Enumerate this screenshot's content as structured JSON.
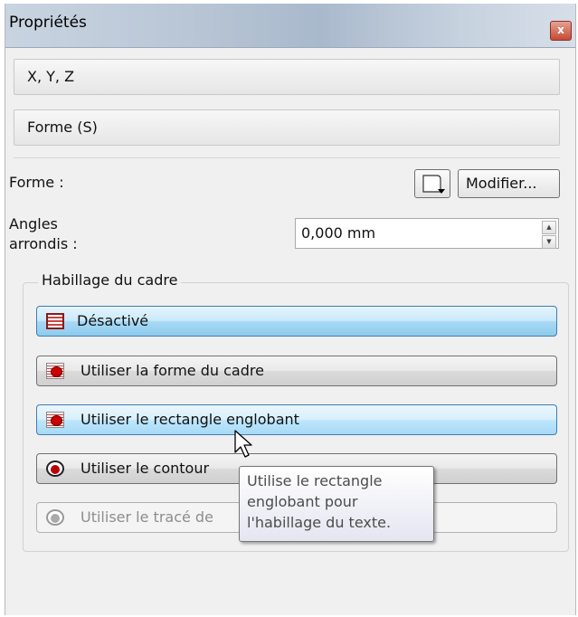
{
  "window": {
    "title": "Propriétés",
    "close_glyph": "x"
  },
  "sections": {
    "xyz": "X, Y, Z",
    "shape": "Forme (S)"
  },
  "shape_row": {
    "label": "Forme :",
    "modify_button": "Modifier..."
  },
  "corners": {
    "label_line1": "Angles",
    "label_line2": "arrondis :",
    "value": "0,000 mm"
  },
  "text_flow": {
    "group_title": "Habillage du cadre",
    "options": [
      {
        "label": "Désactivé",
        "icon": "frame-off-icon",
        "state": "selected"
      },
      {
        "label": "Utiliser la forme du cadre",
        "icon": "frame-shape-icon",
        "state": "normal"
      },
      {
        "label": "Utiliser le rectangle englobant",
        "icon": "bounding-box-icon",
        "state": "hover"
      },
      {
        "label": "Utiliser le contour",
        "icon": "contour-icon",
        "state": "normal"
      },
      {
        "label": "Utiliser le tracé de",
        "icon": "clip-path-icon",
        "state": "disabled"
      }
    ]
  },
  "tooltip": {
    "lines": [
      "Utilise le rectangle",
      "englobant pour",
      "l'habillage du texte."
    ]
  }
}
